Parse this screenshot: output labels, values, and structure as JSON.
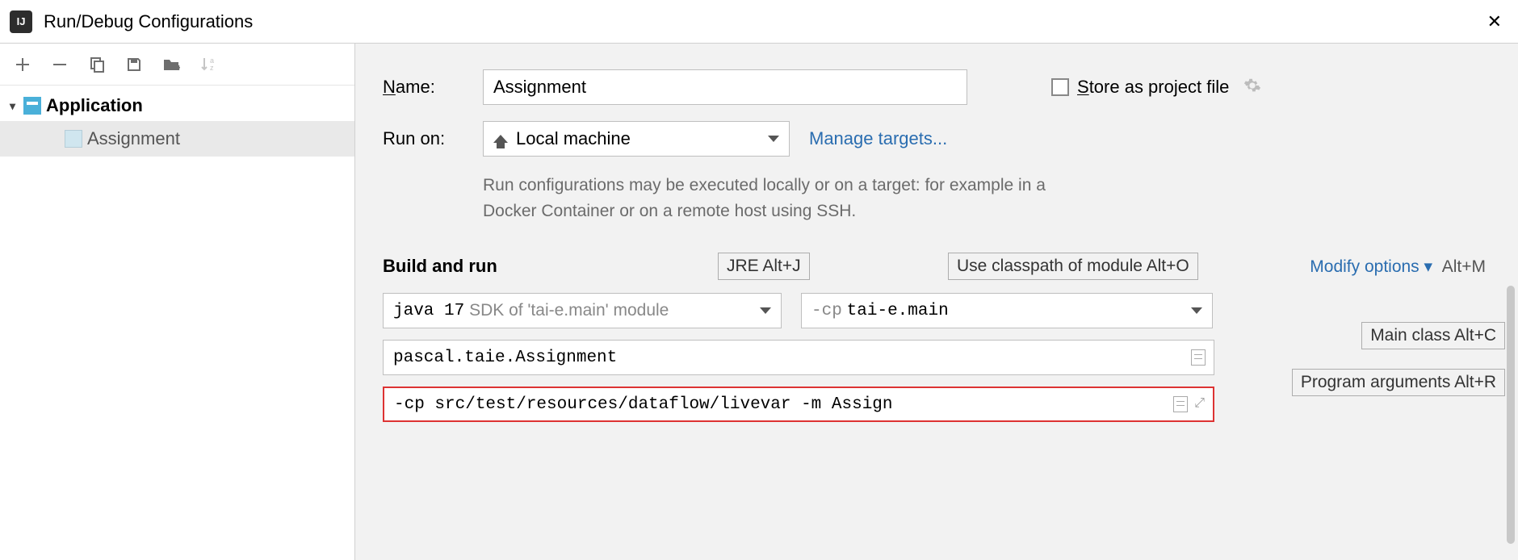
{
  "window": {
    "title": "Run/Debug Configurations"
  },
  "sidebar": {
    "group_label": "Application",
    "items": [
      {
        "label": "Assignment"
      }
    ]
  },
  "form": {
    "name_label": "Name:",
    "name_value": "Assignment",
    "store_label": "Store as project file",
    "run_on_label": "Run on:",
    "run_on_value": "Local machine",
    "manage_targets": "Manage targets...",
    "hint": "Run configurations may be executed locally or on a target: for example in a Docker Container or on a remote host using SSH."
  },
  "build": {
    "section_title": "Build and run",
    "modify_options": "Modify options",
    "modify_shortcut": "Alt+M",
    "jre_tooltip": "JRE Alt+J",
    "cp_tooltip": "Use classpath of module Alt+O",
    "mainclass_tooltip": "Main class Alt+C",
    "args_tooltip": "Program arguments Alt+R",
    "jdk_prefix": "java 17",
    "jdk_suffix": "SDK of 'tai-e.main' module",
    "cp_prefix": "-cp",
    "cp_value": "tai-e.main",
    "main_class": "pascal.taie.Assignment",
    "program_args": "-cp src/test/resources/dataflow/livevar -m Assign"
  }
}
